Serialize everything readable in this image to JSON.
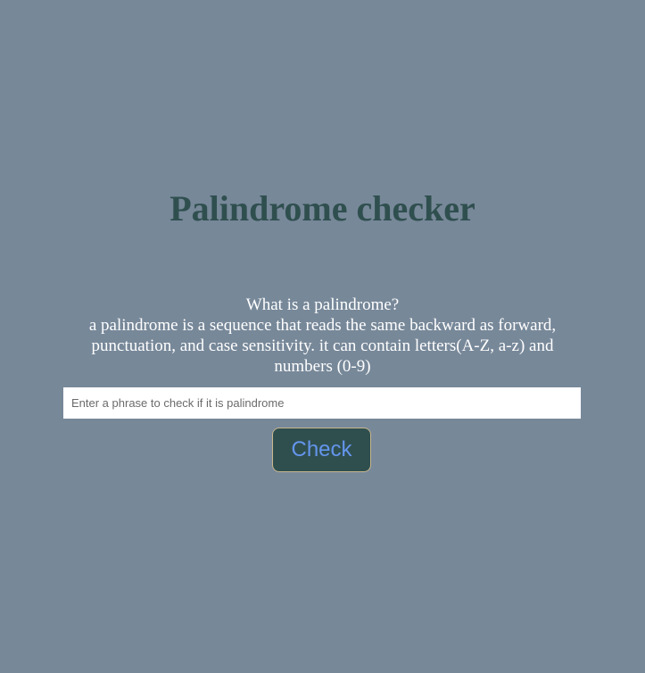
{
  "page": {
    "title": "Palindrome checker"
  },
  "info": {
    "heading": "What is a palindrome?",
    "line1": "a palindrome is a sequence that reads the same backward as forward,",
    "line2": "punctuation, and case sensitivity. it can contain letters(A-Z, a-z) and",
    "line3": "numbers (0-9)"
  },
  "input": {
    "value": "",
    "placeholder": "Enter a phrase to check if it is palindrome"
  },
  "check_button": {
    "label": "Check"
  },
  "colors": {
    "background": "#778899",
    "title": "#2f4f4f",
    "button_bg": "#2f4f4f",
    "button_text": "#6495ed"
  }
}
